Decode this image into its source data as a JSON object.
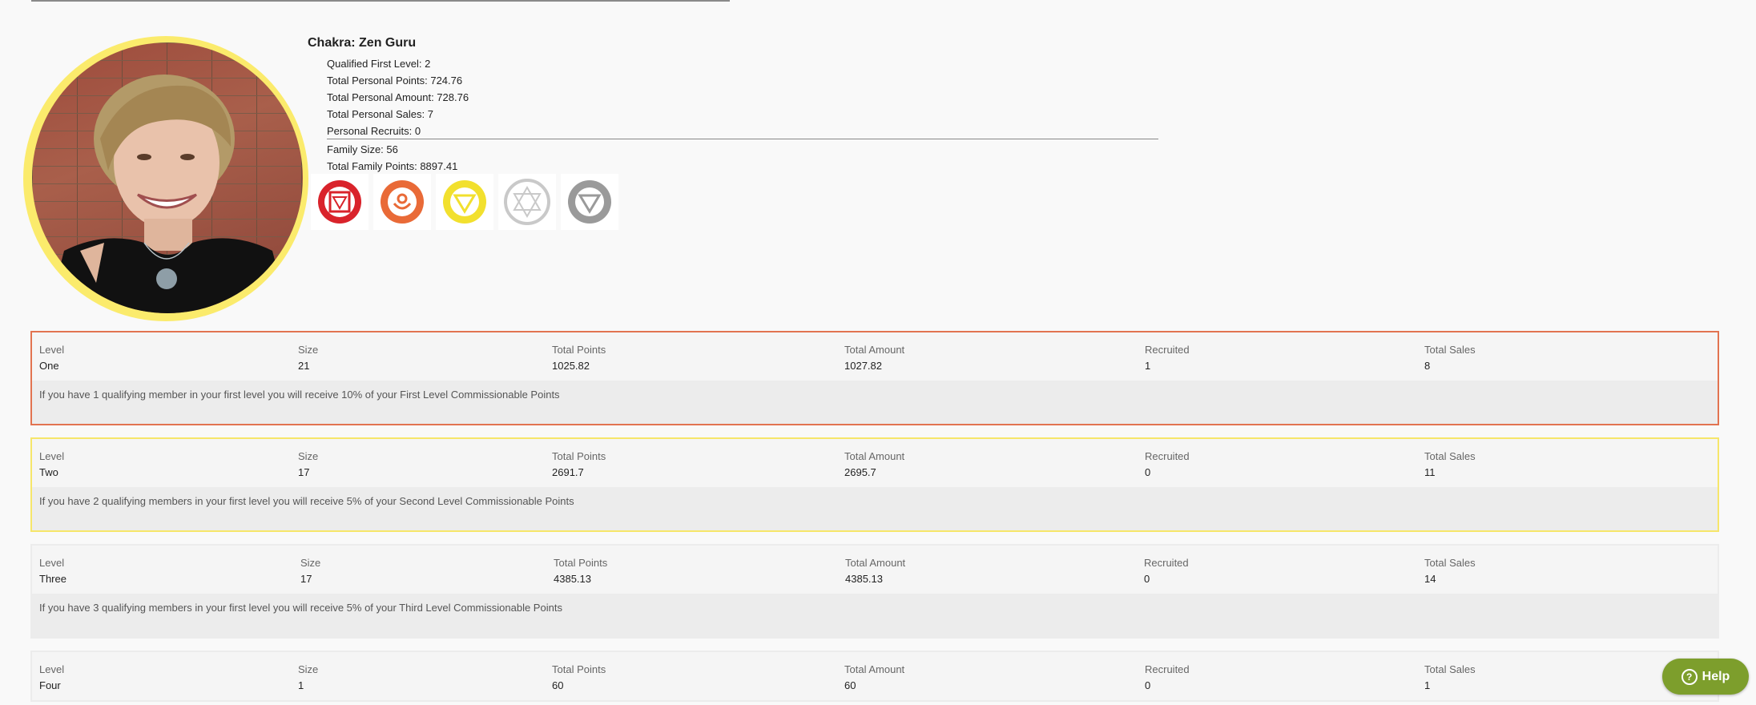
{
  "profile": {
    "name": "Chakra: Zen Guru",
    "qualified_first_level": "Qualified First Level: 2",
    "total_personal_points": "Total Personal Points: 724.76",
    "total_personal_amount": "Total Personal Amount: 728.76",
    "total_personal_sales": "Total Personal Sales: 7",
    "personal_recruits": "Personal Recruits: 0",
    "family_size": "Family Size: 56",
    "total_family_points": "Total Family Points: 8897.41"
  },
  "chakra_icons": [
    {
      "name": "root-chakra-icon",
      "color": "#d9232b"
    },
    {
      "name": "sacral-chakra-icon",
      "color": "#e96a37"
    },
    {
      "name": "solar-plexus-chakra-icon",
      "color": "#f2e02e"
    },
    {
      "name": "heart-chakra-icon",
      "color": "#c9c9c9"
    },
    {
      "name": "throat-chakra-icon",
      "color": "#9a9a9a"
    }
  ],
  "columns": {
    "level": "Level",
    "size": "Size",
    "total_points": "Total Points",
    "total_amount": "Total Amount",
    "recruited": "Recruited",
    "total_sales": "Total Sales"
  },
  "levels": [
    {
      "level": "One",
      "size": "21",
      "total_points": "1025.82",
      "total_amount": "1027.82",
      "recruited": "1",
      "total_sales": "8",
      "note": "If you have 1 qualifying member in your first level you will receive 10% of your First Level Commissionable Points",
      "accent": "#e27350"
    },
    {
      "level": "Two",
      "size": "17",
      "total_points": "2691.7",
      "total_amount": "2695.7",
      "recruited": "0",
      "total_sales": "11",
      "note": "If you have 2 qualifying members in your first level you will receive 5% of your Second Level Commissionable Points",
      "accent": "#f6e66a"
    },
    {
      "level": "Three",
      "size": "17",
      "total_points": "4385.13",
      "total_amount": "4385.13",
      "recruited": "0",
      "total_sales": "14",
      "note": "If you have 3 qualifying members in your first level you will receive 5% of your Third Level Commissionable Points",
      "accent": "#ececec"
    },
    {
      "level": "Four",
      "size": "1",
      "total_points": "60",
      "total_amount": "60",
      "recruited": "0",
      "total_sales": "1",
      "note": "",
      "accent": "#ececec"
    }
  ],
  "help": {
    "label": "Help",
    "icon": "question-circle-icon"
  }
}
